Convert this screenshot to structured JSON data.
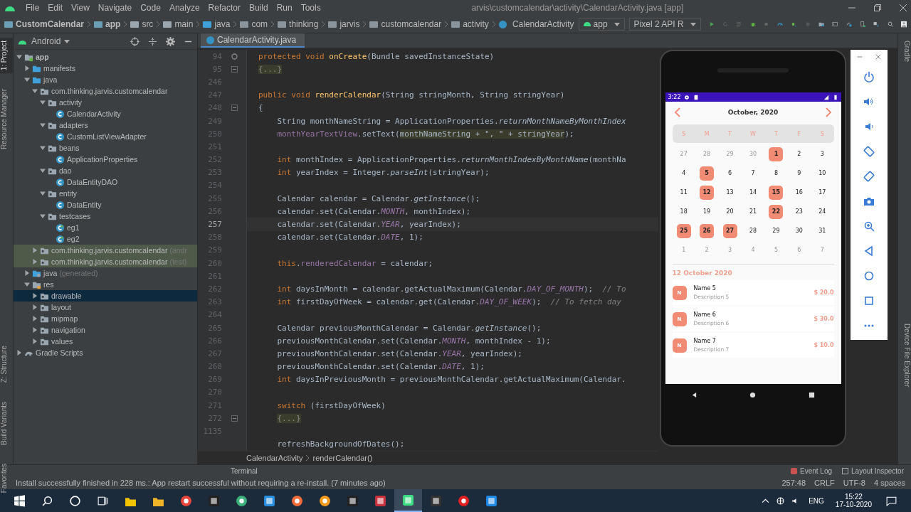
{
  "menu": [
    "File",
    "Edit",
    "View",
    "Navigate",
    "Code",
    "Analyze",
    "Refactor",
    "Build",
    "Run",
    "Tools"
  ],
  "window": {
    "title": "arvis\\customcalendar\\activity\\CalendarActivity.java [app]"
  },
  "breadcrumb": [
    {
      "label": "CustomCalendar",
      "kind": "project"
    },
    {
      "label": "app",
      "kind": "module"
    },
    {
      "label": "src",
      "kind": "folder"
    },
    {
      "label": "main",
      "kind": "folder"
    },
    {
      "label": "java",
      "kind": "source"
    },
    {
      "label": "com",
      "kind": "package"
    },
    {
      "label": "thinking",
      "kind": "package"
    },
    {
      "label": "jarvis",
      "kind": "package"
    },
    {
      "label": "customcalendar",
      "kind": "package"
    },
    {
      "label": "activity",
      "kind": "package"
    },
    {
      "label": "CalendarActivity",
      "kind": "class"
    }
  ],
  "toolbar": {
    "run_config": "app",
    "device": "Pixel 2 API R"
  },
  "left_stripe": [
    {
      "label": "1: Project",
      "selected": true
    },
    {
      "label": "Resource Manager",
      "selected": false
    },
    {
      "label": "Z: Structure",
      "selected": false
    },
    {
      "label": "Build Variants",
      "selected": false
    },
    {
      "label": "Favorites",
      "selected": false
    }
  ],
  "right_stripe": [
    "Gradle",
    "Device File Explorer"
  ],
  "project_panel": {
    "view": "Android"
  },
  "tree": [
    {
      "label": "app",
      "kind": "module",
      "expanded": true,
      "selected": false,
      "shaded": false,
      "children": [
        {
          "label": "manifests",
          "kind": "source",
          "expanded": false,
          "selected": false,
          "shaded": false
        },
        {
          "label": "java",
          "kind": "source",
          "expanded": true,
          "selected": false,
          "shaded": false,
          "children": [
            {
              "label": "com.thinking.jarvis.customcalendar",
              "kind": "package",
              "expanded": true,
              "selected": false,
              "shaded": false,
              "children": [
                {
                  "label": "activity",
                  "kind": "package",
                  "expanded": true,
                  "selected": false,
                  "shaded": false,
                  "children": [
                    {
                      "label": "CalendarActivity",
                      "kind": "class",
                      "selected": false,
                      "shaded": false
                    }
                  ]
                },
                {
                  "label": "adapters",
                  "kind": "package",
                  "expanded": true,
                  "selected": false,
                  "shaded": false,
                  "children": [
                    {
                      "label": "CustomListViewAdapter",
                      "kind": "class",
                      "selected": false,
                      "shaded": false
                    }
                  ]
                },
                {
                  "label": "beans",
                  "kind": "package",
                  "expanded": true,
                  "selected": false,
                  "shaded": false,
                  "children": [
                    {
                      "label": "ApplicationProperties",
                      "kind": "class",
                      "selected": false,
                      "shaded": false
                    }
                  ]
                },
                {
                  "label": "dao",
                  "kind": "package",
                  "expanded": true,
                  "selected": false,
                  "shaded": false,
                  "children": [
                    {
                      "label": "DataEntityDAO",
                      "kind": "class",
                      "selected": false,
                      "shaded": false
                    }
                  ]
                },
                {
                  "label": "entity",
                  "kind": "package",
                  "expanded": true,
                  "selected": false,
                  "shaded": false,
                  "children": [
                    {
                      "label": "DataEntity",
                      "kind": "class",
                      "selected": false,
                      "shaded": false
                    }
                  ]
                },
                {
                  "label": "testcases",
                  "kind": "package",
                  "expanded": true,
                  "selected": false,
                  "shaded": false,
                  "children": [
                    {
                      "label": "eg1",
                      "kind": "test",
                      "selected": false,
                      "shaded": false
                    },
                    {
                      "label": "eg2",
                      "kind": "test",
                      "selected": false,
                      "shaded": false
                    }
                  ]
                }
              ]
            },
            {
              "label": "com.thinking.jarvis.customcalendar",
              "suffix": "(andr",
              "kind": "package",
              "expanded": false,
              "selected": false,
              "shaded": true
            },
            {
              "label": "com.thinking.jarvis.customcalendar",
              "suffix": "(test)",
              "kind": "package",
              "expanded": false,
              "selected": false,
              "shaded": true
            }
          ]
        },
        {
          "label": "java",
          "suffix": "(generated)",
          "kind": "generated",
          "expanded": false,
          "selected": false,
          "shaded": false
        },
        {
          "label": "res",
          "kind": "res",
          "expanded": true,
          "selected": false,
          "shaded": false,
          "children": [
            {
              "label": "drawable",
              "kind": "package",
              "expanded": false,
              "selected": true,
              "shaded": false
            },
            {
              "label": "layout",
              "kind": "package",
              "expanded": false,
              "selected": false,
              "shaded": false
            },
            {
              "label": "mipmap",
              "kind": "package",
              "expanded": false,
              "selected": false,
              "shaded": false
            },
            {
              "label": "navigation",
              "kind": "package",
              "expanded": false,
              "selected": false,
              "shaded": false
            },
            {
              "label": "values",
              "kind": "package",
              "expanded": false,
              "selected": false,
              "shaded": false
            }
          ]
        }
      ]
    },
    {
      "label": "Gradle Scripts",
      "kind": "gradle",
      "expanded": false,
      "selected": false,
      "shaded": false
    }
  ],
  "editor_tabs": [
    {
      "label": "CalendarActivity.java",
      "selected": true
    }
  ],
  "code": [
    {
      "number": "94",
      "marker": {
        "kind": "override"
      },
      "current": false,
      "indented": false,
      "tokens": [
        {
          "text": "protected void ",
          "kind": "keyword"
        },
        {
          "text": "onCreate",
          "kind": "method"
        },
        {
          "text": "(Bundle savedInstanceState)",
          "kind": "plain"
        }
      ]
    },
    {
      "number": "95",
      "marker": {
        "kind": "fold"
      },
      "current": false,
      "indented": false,
      "tokens": [
        {
          "text": "{...}",
          "kind": "folded"
        }
      ]
    },
    {
      "number": "246",
      "current": false
    },
    {
      "number": "247",
      "current": false,
      "indented": false,
      "tokens": [
        {
          "text": "public void ",
          "kind": "keyword"
        },
        {
          "text": "renderCalendar",
          "kind": "method"
        },
        {
          "text": "(String stringMonth, String stringYear)",
          "kind": "plain"
        }
      ]
    },
    {
      "number": "248",
      "marker": {
        "kind": "fold"
      },
      "current": false,
      "indented": false,
      "tokens": [
        {
          "text": "{",
          "kind": "plain"
        }
      ]
    },
    {
      "number": "249",
      "current": false,
      "indented": true,
      "tokens": [
        {
          "text": "String monthNameString = ApplicationProperties.",
          "kind": "plain"
        },
        {
          "text": "returnMonthNameByMonthIndex",
          "kind": "static"
        }
      ]
    },
    {
      "number": "250",
      "current": false,
      "indented": true,
      "tokens": [
        {
          "text": "monthYearTextView",
          "kind": "field"
        },
        {
          "text": ".setText(",
          "kind": "plain"
        },
        {
          "text": "monthNameString + \", \" + stringYear",
          "kind": "highlight"
        },
        {
          "text": ");",
          "kind": "plain"
        }
      ]
    },
    {
      "number": "251",
      "current": false
    },
    {
      "number": "252",
      "current": false,
      "indented": true,
      "tokens": [
        {
          "text": "int ",
          "kind": "keyword"
        },
        {
          "text": "monthIndex = ApplicationProperties.",
          "kind": "plain"
        },
        {
          "text": "returnMonthIndexByMonthName",
          "kind": "static"
        },
        {
          "text": "(monthNa",
          "kind": "plain"
        }
      ]
    },
    {
      "number": "253",
      "current": false,
      "indented": true,
      "tokens": [
        {
          "text": "int ",
          "kind": "keyword"
        },
        {
          "text": "yearIndex = Integer.",
          "kind": "plain"
        },
        {
          "text": "parseInt",
          "kind": "static"
        },
        {
          "text": "(stringYear);",
          "kind": "plain"
        }
      ]
    },
    {
      "number": "254",
      "current": false
    },
    {
      "number": "255",
      "current": false,
      "indented": true,
      "tokens": [
        {
          "text": "Calendar calendar = Calendar.",
          "kind": "plain"
        },
        {
          "text": "getInstance",
          "kind": "static"
        },
        {
          "text": "();",
          "kind": "plain"
        }
      ]
    },
    {
      "number": "256",
      "current": false,
      "indented": true,
      "tokens": [
        {
          "text": "calendar.set(Calendar.",
          "kind": "plain"
        },
        {
          "text": "MONTH",
          "kind": "constant"
        },
        {
          "text": ", monthIndex);",
          "kind": "plain"
        }
      ]
    },
    {
      "number": "257",
      "current": true,
      "indented": true,
      "tokens": [
        {
          "text": "calendar.set(Calendar.",
          "kind": "plain"
        },
        {
          "text": "YEAR",
          "kind": "constant"
        },
        {
          "text": ", yearIndex);",
          "kind": "plain"
        }
      ]
    },
    {
      "number": "258",
      "current": false,
      "indented": true,
      "tokens": [
        {
          "text": "calendar.set(Calendar.",
          "kind": "plain"
        },
        {
          "text": "DATE",
          "kind": "constant"
        },
        {
          "text": ", 1);",
          "kind": "plain"
        }
      ]
    },
    {
      "number": "259",
      "current": false
    },
    {
      "number": "260",
      "current": false,
      "indented": true,
      "tokens": [
        {
          "text": "this",
          "kind": "keyword"
        },
        {
          "text": ".",
          "kind": "plain"
        },
        {
          "text": "renderedCalendar",
          "kind": "field"
        },
        {
          "text": " = calendar;",
          "kind": "plain"
        }
      ]
    },
    {
      "number": "261",
      "current": false
    },
    {
      "number": "262",
      "current": false,
      "indented": true,
      "tokens": [
        {
          "text": "int ",
          "kind": "keyword"
        },
        {
          "text": "daysInMonth = calendar.getActualMaximum(Calendar.",
          "kind": "plain"
        },
        {
          "text": "DAY_OF_MONTH",
          "kind": "constant"
        },
        {
          "text": ");  ",
          "kind": "plain"
        },
        {
          "text": "// To",
          "kind": "comment"
        }
      ]
    },
    {
      "number": "263",
      "current": false,
      "indented": true,
      "tokens": [
        {
          "text": "int ",
          "kind": "keyword"
        },
        {
          "text": "firstDayOfWeek = calendar.get(Calendar.",
          "kind": "plain"
        },
        {
          "text": "DAY_OF_WEEK",
          "kind": "constant"
        },
        {
          "text": ");  ",
          "kind": "plain"
        },
        {
          "text": "// To fetch day",
          "kind": "comment"
        }
      ]
    },
    {
      "number": "264",
      "current": false
    },
    {
      "number": "265",
      "current": false,
      "indented": true,
      "tokens": [
        {
          "text": "Calendar previousMonthCalendar = Calendar.",
          "kind": "plain"
        },
        {
          "text": "getInstance",
          "kind": "static"
        },
        {
          "text": "();",
          "kind": "plain"
        }
      ]
    },
    {
      "number": "266",
      "current": false,
      "indented": true,
      "tokens": [
        {
          "text": "previousMonthCalendar.set(Calendar.",
          "kind": "plain"
        },
        {
          "text": "MONTH",
          "kind": "constant"
        },
        {
          "text": ", monthIndex - 1);",
          "kind": "plain"
        }
      ]
    },
    {
      "number": "267",
      "current": false,
      "indented": true,
      "tokens": [
        {
          "text": "previousMonthCalendar.set(Calendar.",
          "kind": "plain"
        },
        {
          "text": "YEAR",
          "kind": "constant"
        },
        {
          "text": ", yearIndex);",
          "kind": "plain"
        }
      ]
    },
    {
      "number": "268",
      "current": false,
      "indented": true,
      "tokens": [
        {
          "text": "previousMonthCalendar.set(Calendar.",
          "kind": "plain"
        },
        {
          "text": "DATE",
          "kind": "constant"
        },
        {
          "text": ", 1);",
          "kind": "plain"
        }
      ]
    },
    {
      "number": "269",
      "current": false,
      "indented": true,
      "tokens": [
        {
          "text": "int ",
          "kind": "keyword"
        },
        {
          "text": "daysInPreviousMonth = previousMonthCalendar.getActualMaximum(Calendar.",
          "kind": "plain"
        }
      ]
    },
    {
      "number": "270",
      "current": false
    },
    {
      "number": "271",
      "current": false,
      "indented": true,
      "tokens": [
        {
          "text": "switch ",
          "kind": "keyword"
        },
        {
          "text": "(firstDayOfWeek)",
          "kind": "plain"
        }
      ]
    },
    {
      "number": "272",
      "marker": {
        "kind": "fold"
      },
      "current": false,
      "indented": true,
      "tokens": [
        {
          "text": "{...}",
          "kind": "folded"
        }
      ]
    },
    {
      "number": "1135",
      "current": false
    },
    {
      "current": false,
      "indented": true,
      "tokens": [
        {
          "text": "refreshBackgroundOfDates();",
          "kind": "plain"
        }
      ]
    }
  ],
  "editor_breadcrumb": [
    "CalendarActivity",
    "renderCalendar()"
  ],
  "phone": {
    "time": "3:22",
    "month_title": "October, 2020",
    "weekdays": [
      "S",
      "M",
      "T",
      "W",
      "T",
      "F",
      "S"
    ],
    "weeks": [
      [
        {
          "day": "27",
          "kind": "other",
          "event": false
        },
        {
          "day": "28",
          "kind": "other",
          "event": false
        },
        {
          "day": "29",
          "kind": "other",
          "event": false
        },
        {
          "day": "30",
          "kind": "other",
          "event": false
        },
        {
          "day": "1",
          "kind": "current",
          "event": true
        },
        {
          "day": "2",
          "kind": "current",
          "event": false
        },
        {
          "day": "3",
          "kind": "current",
          "event": false
        }
      ],
      [
        {
          "day": "4",
          "kind": "current",
          "event": false
        },
        {
          "day": "5",
          "kind": "current",
          "event": true
        },
        {
          "day": "6",
          "kind": "current",
          "event": false
        },
        {
          "day": "7",
          "kind": "current",
          "event": false
        },
        {
          "day": "8",
          "kind": "current",
          "event": false
        },
        {
          "day": "9",
          "kind": "current",
          "event": false
        },
        {
          "day": "10",
          "kind": "current",
          "event": false
        }
      ],
      [
        {
          "day": "11",
          "kind": "current",
          "event": false
        },
        {
          "day": "12",
          "kind": "current",
          "event": true
        },
        {
          "day": "13",
          "kind": "current",
          "event": false
        },
        {
          "day": "14",
          "kind": "current",
          "event": false
        },
        {
          "day": "15",
          "kind": "current",
          "event": true
        },
        {
          "day": "16",
          "kind": "current",
          "event": false
        },
        {
          "day": "17",
          "kind": "current",
          "event": false
        }
      ],
      [
        {
          "day": "18",
          "kind": "current",
          "event": false
        },
        {
          "day": "19",
          "kind": "current",
          "event": false
        },
        {
          "day": "20",
          "kind": "current",
          "event": false
        },
        {
          "day": "21",
          "kind": "current",
          "event": false
        },
        {
          "day": "22",
          "kind": "current",
          "event": true
        },
        {
          "day": "23",
          "kind": "current",
          "event": false
        },
        {
          "day": "24",
          "kind": "current",
          "event": false
        }
      ],
      [
        {
          "day": "25",
          "kind": "current",
          "event": true
        },
        {
          "day": "26",
          "kind": "current",
          "event": true
        },
        {
          "day": "27",
          "kind": "current",
          "event": true
        },
        {
          "day": "28",
          "kind": "current",
          "event": false
        },
        {
          "day": "29",
          "kind": "current",
          "event": false
        },
        {
          "day": "30",
          "kind": "current",
          "event": false
        },
        {
          "day": "31",
          "kind": "current",
          "event": false
        }
      ],
      [
        {
          "day": "1",
          "kind": "other",
          "event": false
        },
        {
          "day": "2",
          "kind": "other",
          "event": false
        },
        {
          "day": "3",
          "kind": "other",
          "event": false
        },
        {
          "day": "4",
          "kind": "other",
          "event": false
        },
        {
          "day": "5",
          "kind": "other",
          "event": false
        },
        {
          "day": "6",
          "kind": "other",
          "event": false
        },
        {
          "day": "7",
          "kind": "other",
          "event": false
        }
      ]
    ],
    "selected_date": "12 October 2020",
    "events": [
      {
        "initial": "N",
        "name": "Name 5",
        "description": "Description 5",
        "price": "$ 20.0"
      },
      {
        "initial": "N",
        "name": "Name 6",
        "description": "Description 6",
        "price": "$ 30.0"
      },
      {
        "initial": "N",
        "name": "Name 7",
        "description": "Description 7",
        "price": "$ 10.0"
      }
    ]
  },
  "tool_windows": {
    "left": [
      {
        "label": "Terminal"
      }
    ],
    "right": [
      {
        "label": "Event Log",
        "kind": "event"
      },
      {
        "label": "Layout Inspector",
        "kind": "inspector"
      }
    ]
  },
  "status_bar": {
    "message": "Install successfully finished in 228 ms.: App restart successful without requiring a re-install. (7 minutes ago)",
    "position": "257:48",
    "line_separator": "CRLF",
    "encoding": "UTF-8",
    "indent": "4 spaces"
  },
  "taskbar": {
    "apps": [
      {
        "kind": "store",
        "selected": false
      },
      {
        "kind": "explorer",
        "selected": false
      },
      {
        "kind": "chrome",
        "selected": false
      },
      {
        "kind": "terminal",
        "selected": false
      },
      {
        "kind": "maps",
        "selected": false
      },
      {
        "kind": "vscode",
        "selected": false
      },
      {
        "kind": "postman",
        "selected": false
      },
      {
        "kind": "orange",
        "selected": false
      },
      {
        "kind": "intellij",
        "selected": false
      },
      {
        "kind": "tool",
        "selected": false
      },
      {
        "kind": "studio",
        "selected": true
      },
      {
        "kind": "notes",
        "selected": false
      },
      {
        "kind": "record",
        "selected": false
      },
      {
        "kind": "player",
        "selected": false
      }
    ],
    "language": "ENG",
    "time": "15:22",
    "date": "17-10-2020"
  }
}
